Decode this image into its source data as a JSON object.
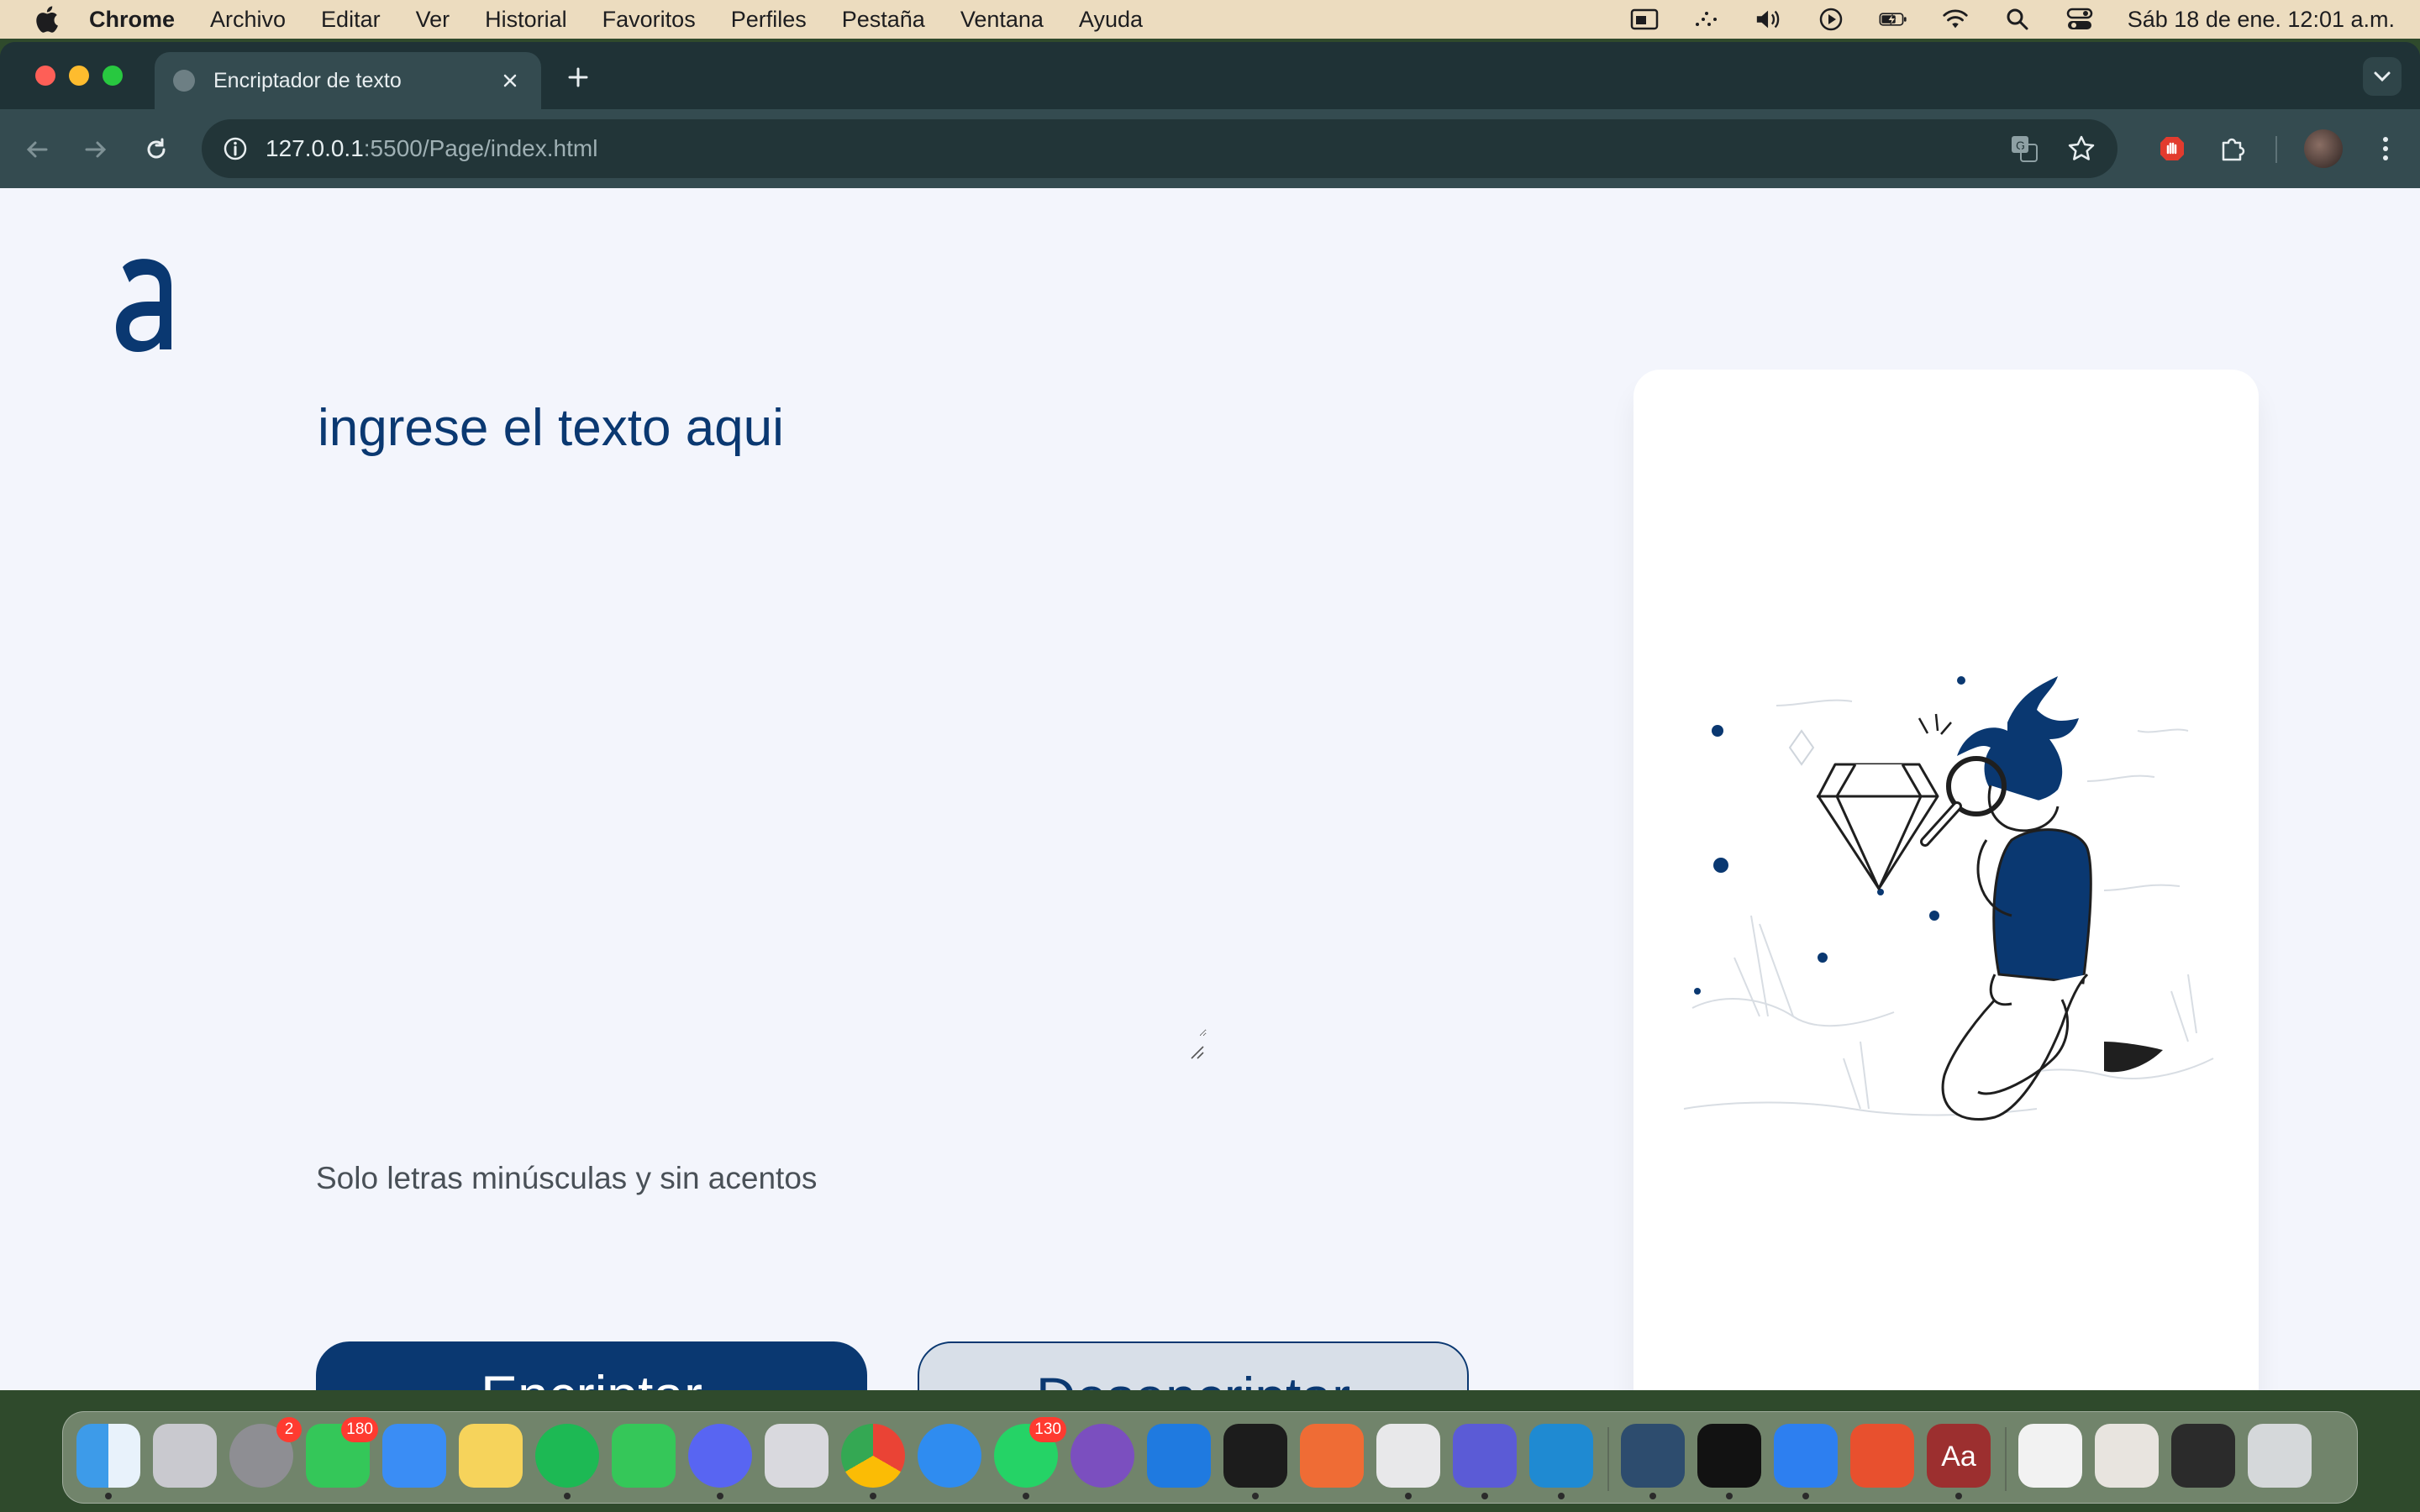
{
  "menubar": {
    "app_name": "Chrome",
    "items": [
      "Archivo",
      "Editar",
      "Ver",
      "Historial",
      "Favoritos",
      "Perfiles",
      "Pestaña",
      "Ventana",
      "Ayuda"
    ],
    "clock": "Sáb 18 de ene.  12:01 a.m.",
    "status_icons": [
      "screen-mirror-icon",
      "dots-icon",
      "volume-icon",
      "play-icon",
      "battery-charging-icon",
      "wifi-icon",
      "spotlight-search-icon",
      "control-center-icon"
    ]
  },
  "browser": {
    "tab_title": "Encriptador de texto",
    "url_host": "127.0.0.1",
    "url_rest": ":5500/Page/index.html"
  },
  "page": {
    "logo_letter": "a",
    "textarea_placeholder": "ingrese el texto aqui",
    "hint": "Solo letras minúsculas y sin acentos",
    "encrypt_label": "Encriptar",
    "decrypt_label": "Desencriptar",
    "accent_color": "#0a3871"
  },
  "dock": {
    "apps": [
      {
        "name": "finder",
        "color": "#3d9be9"
      },
      {
        "name": "launchpad",
        "color": "#c9c9cf"
      },
      {
        "name": "system-settings",
        "color": "#8e8e93",
        "badge": "2"
      },
      {
        "name": "messages",
        "color": "#34c759",
        "badge": "180"
      },
      {
        "name": "mail",
        "color": "#3a8df5"
      },
      {
        "name": "notes",
        "color": "#f6d35b"
      },
      {
        "name": "spotify",
        "color": "#1db954"
      },
      {
        "name": "facetime",
        "color": "#35c759"
      },
      {
        "name": "discord",
        "color": "#5865f2"
      },
      {
        "name": "iphone-mirroring",
        "color": "#d9d9de"
      },
      {
        "name": "chrome",
        "color": "#f1f1f1"
      },
      {
        "name": "safari",
        "color": "#2f8cf0"
      },
      {
        "name": "whatsapp",
        "color": "#25d366",
        "badge": "130"
      },
      {
        "name": "github-desktop",
        "color": "#7b4fbf"
      },
      {
        "name": "xcode",
        "color": "#1f7ae0"
      },
      {
        "name": "terminal",
        "color": "#1c1c1c"
      },
      {
        "name": "postman",
        "color": "#ef6c35"
      },
      {
        "name": "screen-sharing",
        "color": "#e8e8ea"
      },
      {
        "name": "linear",
        "color": "#5b5bd6"
      },
      {
        "name": "vscode",
        "color": "#1f8ad2"
      },
      {
        "name": "mysql-workbench",
        "color": "#2d4c6e"
      },
      {
        "name": "unity",
        "color": "#121212"
      },
      {
        "name": "windows-app",
        "color": "#2d7ff0"
      },
      {
        "name": "netbeans",
        "color": "#e8502e"
      },
      {
        "name": "dictionary",
        "color": "#9c2f2f",
        "label": "Aa"
      },
      {
        "name": "recent-window-1",
        "color": "#f2f2f2"
      },
      {
        "name": "recent-window-2",
        "color": "#e8e4df"
      },
      {
        "name": "recent-window-3",
        "color": "#2b2b2b"
      },
      {
        "name": "trash",
        "color": "#d5d8da"
      }
    ]
  }
}
